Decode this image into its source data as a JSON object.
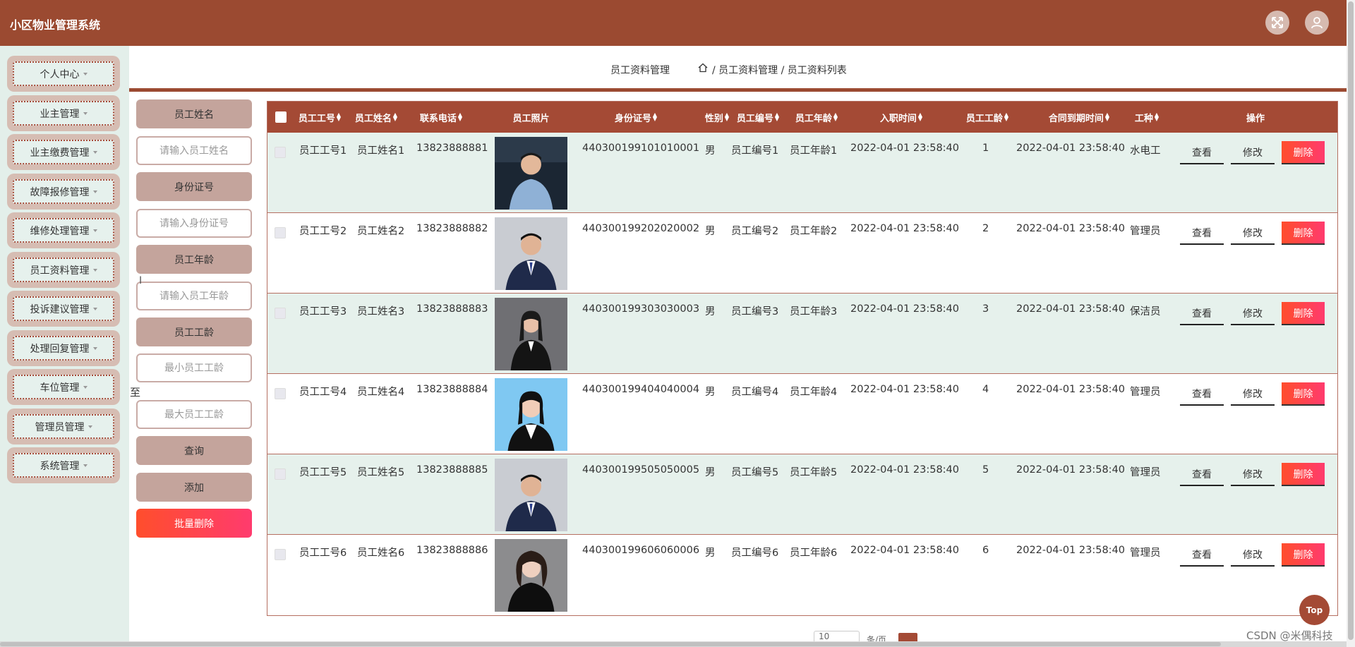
{
  "app": {
    "title": "小区物业管理系统"
  },
  "header_icons": {
    "fullscreen": "fullscreen-icon",
    "user": "user-icon"
  },
  "sidebar": {
    "items": [
      {
        "label": "个人中心"
      },
      {
        "label": "业主管理"
      },
      {
        "label": "业主缴费管理"
      },
      {
        "label": "故障报修管理"
      },
      {
        "label": "维修处理管理"
      },
      {
        "label": "员工资料管理"
      },
      {
        "label": "投诉建议管理"
      },
      {
        "label": "处理回复管理"
      },
      {
        "label": "车位管理"
      },
      {
        "label": "管理员管理"
      },
      {
        "label": "系统管理"
      }
    ]
  },
  "breadcrumb": {
    "title": "员工资料管理",
    "path": "/ 员工资料管理 / 员工资料列表"
  },
  "search": {
    "name_label": "员工姓名",
    "name_placeholder": "请输入员工姓名",
    "id_label": "身份证号",
    "id_placeholder": "请输入身份证号",
    "age_label": "员工年龄",
    "age_placeholder": "请输入员工年龄",
    "seniority_label": "员工工龄",
    "min_placeholder": "最小员工工龄",
    "to_label": "至",
    "max_placeholder": "最大员工工龄",
    "query_button": "查询",
    "add_button": "添加",
    "batch_delete_button": "批量删除"
  },
  "table": {
    "columns": [
      "员工工号",
      "员工姓名",
      "联系电话",
      "员工照片",
      "身份证号",
      "性别",
      "员工编号",
      "员工年龄",
      "入职时间",
      "员工工龄",
      "合同到期时间",
      "工种",
      "操作"
    ],
    "rows": [
      {
        "emp_no": "员工工号1",
        "name": "员工姓名1",
        "phone": "13823888881",
        "id_card": "440300199101010001",
        "gender": "男",
        "code": "员工编号1",
        "age": "员工年龄1",
        "hire_date": "2022-04-01 23:58:40",
        "seniority": "1",
        "contract_end": "2022-04-01 23:58:40",
        "job": "水电工"
      },
      {
        "emp_no": "员工工号2",
        "name": "员工姓名2",
        "phone": "13823888882",
        "id_card": "440300199202020002",
        "gender": "男",
        "code": "员工编号2",
        "age": "员工年龄2",
        "hire_date": "2022-04-01 23:58:40",
        "seniority": "2",
        "contract_end": "2022-04-01 23:58:40",
        "job": "管理员"
      },
      {
        "emp_no": "员工工号3",
        "name": "员工姓名3",
        "phone": "13823888883",
        "id_card": "440300199303030003",
        "gender": "男",
        "code": "员工编号3",
        "age": "员工年龄3",
        "hire_date": "2022-04-01 23:58:40",
        "seniority": "3",
        "contract_end": "2022-04-01 23:58:40",
        "job": "保洁员"
      },
      {
        "emp_no": "员工工号4",
        "name": "员工姓名4",
        "phone": "13823888884",
        "id_card": "440300199404040004",
        "gender": "男",
        "code": "员工编号4",
        "age": "员工年龄4",
        "hire_date": "2022-04-01 23:58:40",
        "seniority": "4",
        "contract_end": "2022-04-01 23:58:40",
        "job": "管理员"
      },
      {
        "emp_no": "员工工号5",
        "name": "员工姓名5",
        "phone": "13823888885",
        "id_card": "440300199505050005",
        "gender": "男",
        "code": "员工编号5",
        "age": "员工年龄5",
        "hire_date": "2022-04-01 23:58:40",
        "seniority": "5",
        "contract_end": "2022-04-01 23:58:40",
        "job": "管理员"
      },
      {
        "emp_no": "员工工号6",
        "name": "员工姓名6",
        "phone": "13823888886",
        "id_card": "440300199606060006",
        "gender": "男",
        "code": "员工编号6",
        "age": "员工年龄6",
        "hire_date": "2022-04-01 23:58:40",
        "seniority": "6",
        "contract_end": "2022-04-01 23:58:40",
        "job": "管理员"
      }
    ],
    "actions": {
      "view": "查看",
      "edit": "修改",
      "delete": "删除"
    }
  },
  "footer": {
    "top_button": "Top",
    "watermark": "CSDN @米偶科技",
    "page_size": "10",
    "page_size_suffix": "条/页"
  },
  "colors": {
    "primary": "#9b4a31",
    "sidebar_bg": "#e3efea",
    "row_alt": "#e6f1ec",
    "danger": "#ff3b5c"
  }
}
